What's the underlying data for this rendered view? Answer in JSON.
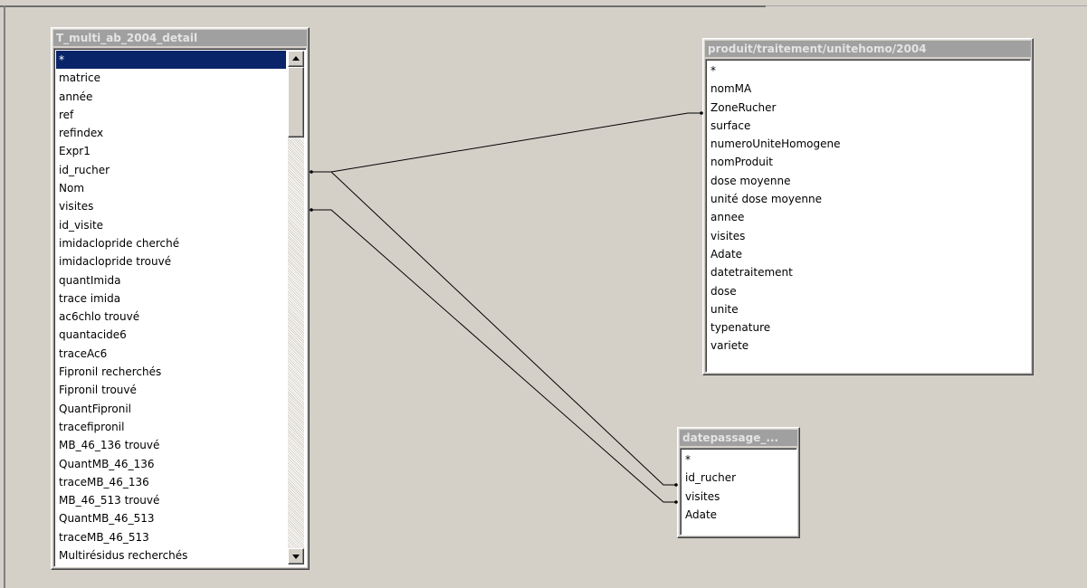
{
  "tables": [
    {
      "id": "t_multi",
      "title": "T_multi_ab_2004_detail",
      "fields": [
        "*",
        "matrice",
        "année",
        "ref",
        "refindex",
        "Expr1",
        "id_rucher",
        "Nom",
        "visites",
        "id_visite",
        "imidaclopride cherché",
        "imidaclopride trouvé",
        "quantImida",
        "trace imida",
        "ac6chlo trouvé",
        "quantacide6",
        "traceAc6",
        "Fipronil recherchés",
        "Fipronil trouvé",
        "QuantFipronil",
        "tracefipronil",
        "MB_46_136 trouvé",
        "QuantMB_46_136",
        "traceMB_46_136",
        "MB_46_513 trouvé",
        "QuantMB_46_513",
        "traceMB_46_513",
        "Multirésidus recherchés"
      ],
      "selected_index": 0
    },
    {
      "id": "produit",
      "title": "produit/traitement/unitehomo/2004",
      "fields": [
        "*",
        "nomMA",
        "ZoneRucher",
        "surface",
        "numeroUniteHomogene",
        "nomProduit",
        "dose moyenne",
        "unité dose moyenne",
        "annee",
        "visites",
        "Adate",
        "datetraitement",
        "dose",
        "unite",
        "typenature",
        "variete"
      ]
    },
    {
      "id": "datepassage",
      "title": "datepassage_...",
      "fields": [
        "*",
        "id_rucher",
        "visites",
        "Adate"
      ]
    }
  ],
  "relationships": [
    {
      "from_table": "T_multi_ab_2004_detail",
      "from_field": "id_rucher",
      "to_table": "produit/traitement/unitehomo/2004",
      "to_field": "ZoneRucher"
    },
    {
      "from_table": "T_multi_ab_2004_detail",
      "from_field": "id_rucher",
      "to_table": "datepassage_...",
      "to_field": "id_rucher"
    },
    {
      "from_table": "T_multi_ab_2004_detail",
      "from_field": "visites",
      "to_table": "datepassage_...",
      "to_field": "visites"
    }
  ],
  "colors": {
    "background": "#d4d0c8",
    "title_bar_inactive": "#a0a0a0",
    "selection": "#0a246a",
    "list_background": "#ffffff"
  }
}
